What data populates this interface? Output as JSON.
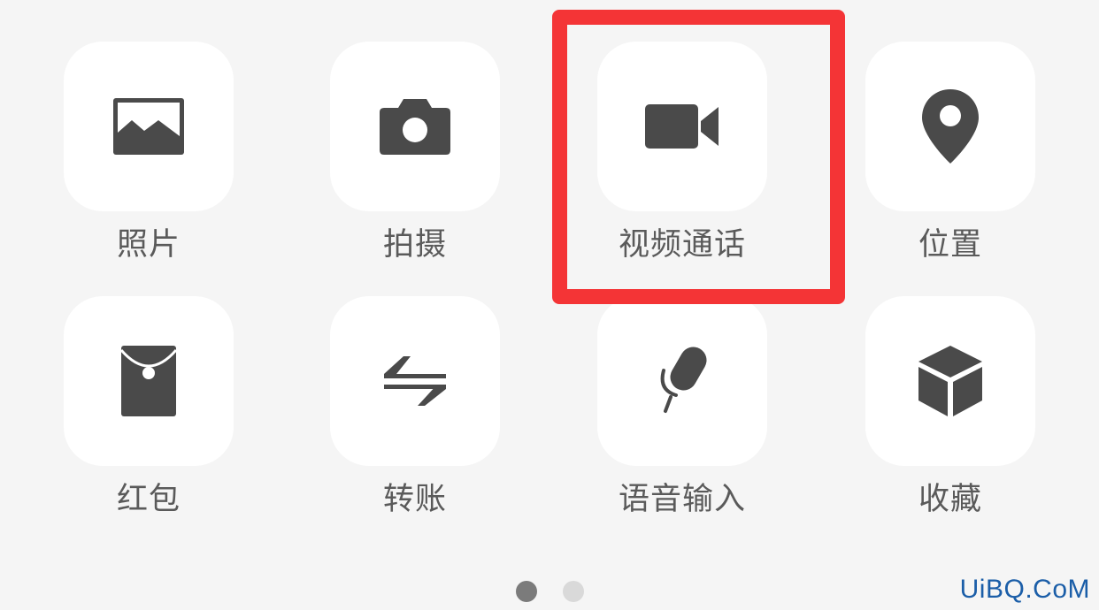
{
  "panel": {
    "row1": [
      {
        "label": "照片",
        "icon": "photo-icon"
      },
      {
        "label": "拍摄",
        "icon": "camera-icon"
      },
      {
        "label": "视频通话",
        "icon": "video-camera-icon"
      },
      {
        "label": "位置",
        "icon": "location-pin-icon"
      }
    ],
    "row2": [
      {
        "label": "红包",
        "icon": "red-envelope-icon"
      },
      {
        "label": "转账",
        "icon": "transfer-arrows-icon"
      },
      {
        "label": "语音输入",
        "icon": "microphone-icon"
      },
      {
        "label": "收藏",
        "icon": "cube-icon"
      }
    ]
  },
  "pagination": {
    "current_page": 1,
    "total_pages": 2
  },
  "highlight": {
    "target": "视频通话",
    "color": "#f43436"
  },
  "watermark": "UiBQ.CoM",
  "colors": {
    "background": "#f5f5f5",
    "tile": "#ffffff",
    "icon": "#4a4a4a",
    "label": "#5a5a5a"
  }
}
